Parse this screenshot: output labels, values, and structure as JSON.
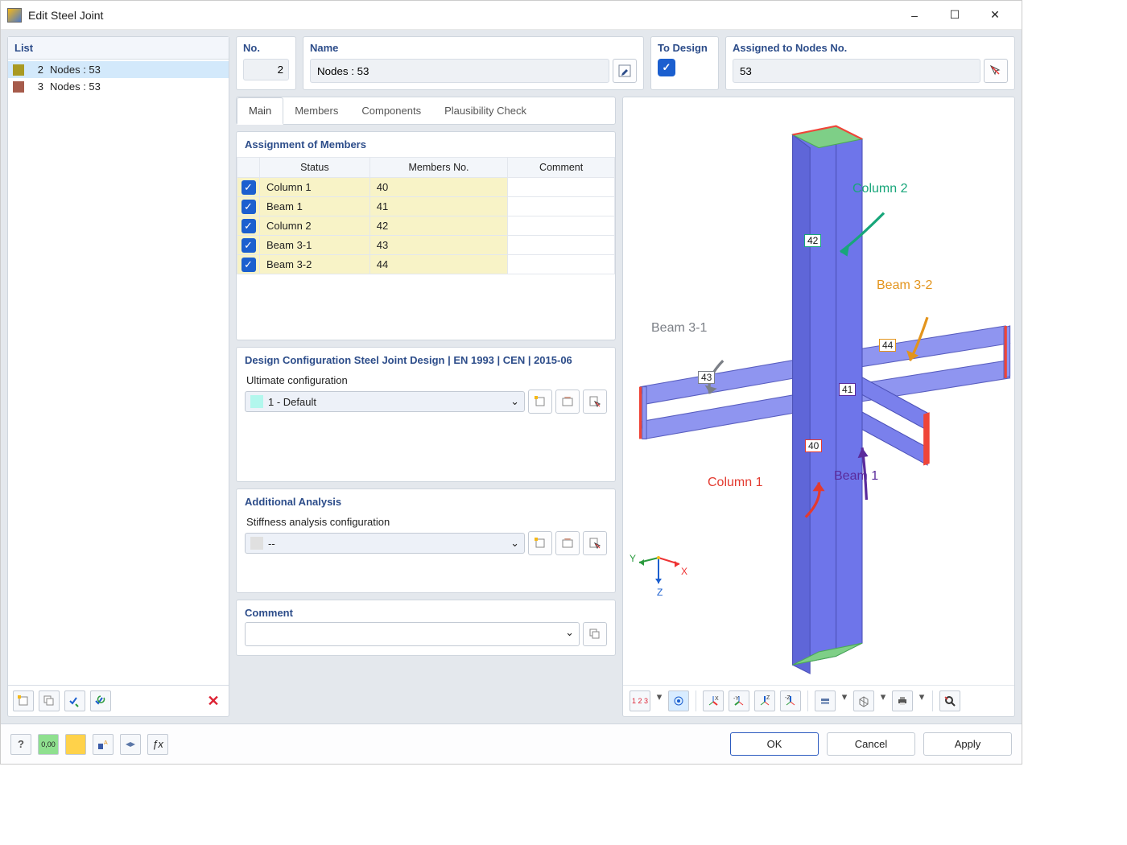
{
  "window": {
    "title": "Edit Steel Joint"
  },
  "list": {
    "header": "List",
    "items": [
      {
        "no": "2",
        "label": "Nodes : 53",
        "color": "#a99a23",
        "selected": true
      },
      {
        "no": "3",
        "label": "Nodes : 53",
        "color": "#a65b4b",
        "selected": false
      }
    ]
  },
  "fields": {
    "no": {
      "label": "No.",
      "value": "2"
    },
    "name": {
      "label": "Name",
      "value": "Nodes : 53"
    },
    "to_design": {
      "label": "To Design",
      "checked": true
    },
    "assigned": {
      "label": "Assigned to Nodes No.",
      "value": "53"
    }
  },
  "tabs": [
    {
      "id": "main",
      "label": "Main",
      "active": true
    },
    {
      "id": "members",
      "label": "Members",
      "active": false
    },
    {
      "id": "components",
      "label": "Components",
      "active": false
    },
    {
      "id": "plaus",
      "label": "Plausibility Check",
      "active": false
    }
  ],
  "assignment": {
    "title": "Assignment of Members",
    "cols": {
      "status": "Status",
      "members_no": "Members No.",
      "comment": "Comment"
    },
    "rows": [
      {
        "checked": true,
        "status": "Column 1",
        "members_no": "40",
        "comment": ""
      },
      {
        "checked": true,
        "status": "Beam 1",
        "members_no": "41",
        "comment": ""
      },
      {
        "checked": true,
        "status": "Column 2",
        "members_no": "42",
        "comment": ""
      },
      {
        "checked": true,
        "status": "Beam 3-1",
        "members_no": "43",
        "comment": ""
      },
      {
        "checked": true,
        "status": "Beam 3-2",
        "members_no": "44",
        "comment": ""
      }
    ]
  },
  "design": {
    "title": "Design Configuration Steel Joint Design | EN 1993 | CEN | 2015-06",
    "sub": "Ultimate configuration",
    "selected": "1 - Default",
    "swatch": "#b2f7ed"
  },
  "additional": {
    "title": "Additional Analysis",
    "sub": "Stiffness analysis configuration",
    "selected": "--",
    "swatch": "#e0e0e0"
  },
  "comment": {
    "title": "Comment",
    "value": ""
  },
  "scene": {
    "labels": {
      "column1": {
        "text": "Column 1",
        "tag": "40",
        "color": "#e33a2f"
      },
      "beam1": {
        "text": "Beam 1",
        "tag": "41",
        "color": "#5a2b9c"
      },
      "column2": {
        "text": "Column 2",
        "tag": "42",
        "color": "#18a67a"
      },
      "beam31": {
        "text": "Beam 3-1",
        "tag": "43",
        "color": "#7b7f86"
      },
      "beam32": {
        "text": "Beam 3-2",
        "tag": "44",
        "color": "#e3941c"
      }
    },
    "axes": {
      "x": "X",
      "y": "Y",
      "z": "Z"
    },
    "colors": {
      "steel": "#6e75ea",
      "edge_red": "#ef4538",
      "edge_teal": "#24b79b",
      "edge_green": "#7ecf87"
    }
  },
  "footer": {
    "ok": "OK",
    "cancel": "Cancel",
    "apply": "Apply"
  }
}
